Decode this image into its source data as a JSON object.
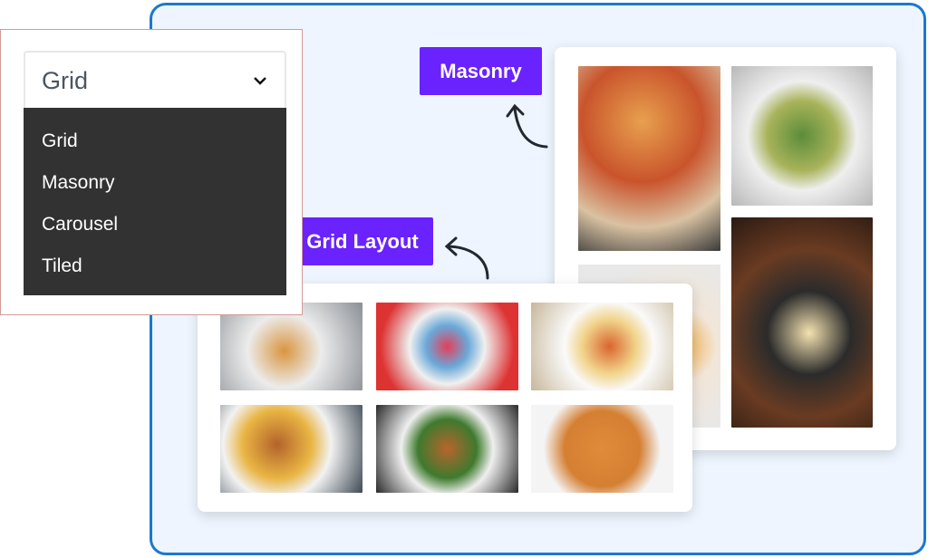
{
  "dropdown": {
    "selected": "Grid",
    "options": [
      "Grid",
      "Masonry",
      "Carousel",
      "Tiled"
    ]
  },
  "labels": {
    "masonry": "Masonry",
    "grid_layout": "Grid Layout"
  },
  "colors": {
    "accent": "#6a22ff",
    "frame": "#1b78cf",
    "menu_bg": "#333232",
    "canvas_bg": "#eef5fe"
  },
  "masonry_images": [
    "pizza",
    "salad",
    "eggs",
    "noodle-bowl"
  ],
  "grid_images": [
    "pancakes",
    "fruit-bowl",
    "spaghetti",
    "burger-fries",
    "chicken-salad",
    "tagliatelle"
  ]
}
